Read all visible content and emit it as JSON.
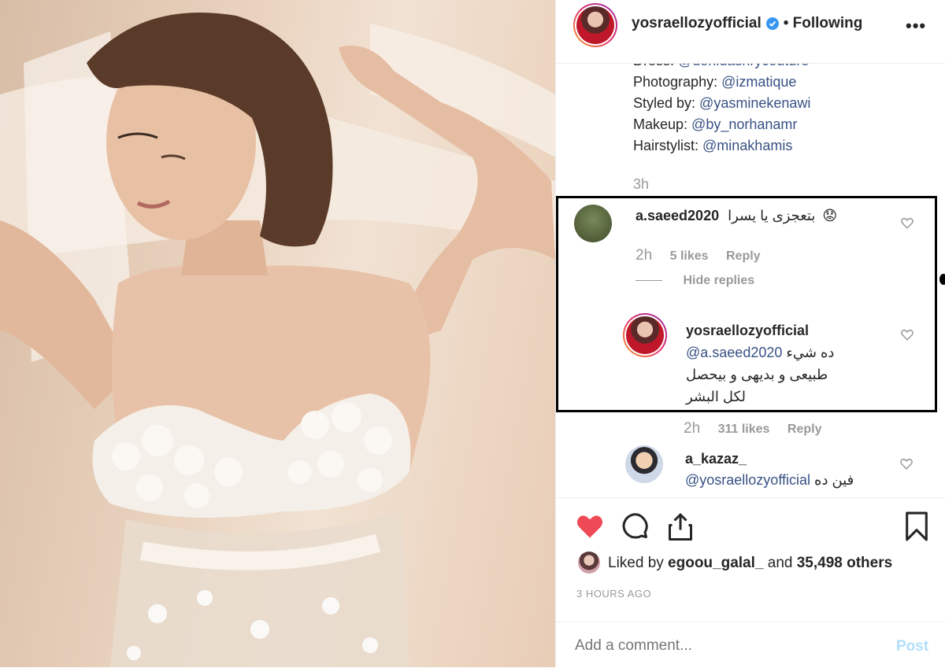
{
  "post": {
    "author": "yosraellozyofficial",
    "follow_status": "• Following",
    "more_icon": "ellipsis-icon",
    "caption_lines": [
      {
        "label": "Dress: ",
        "mention": "@donidashrycouture"
      },
      {
        "label": "Photography: ",
        "mention": "@izmatique"
      },
      {
        "label": "Styled by: ",
        "mention": "@yasminekenawi"
      },
      {
        "label": "Makeup: ",
        "mention": "@by_norhanamr"
      },
      {
        "label": "Hairstylist: ",
        "mention": "@minakhamis"
      }
    ],
    "caption_time": "3h"
  },
  "comments": [
    {
      "username": "a.saeed2020",
      "text": "بتعجزى يا يسرا",
      "emoji": "😟",
      "time": "2h",
      "likes": "5 likes",
      "reply": "Reply",
      "hide_replies": "Hide replies"
    }
  ],
  "reply": {
    "username": "yosraellozyofficial",
    "mention": "@a.saeed2020",
    "text_1": "ده شيء",
    "text_2": "طبيعى و بديهى و بيحصل",
    "text_3": "لكل البشر",
    "time": "2h",
    "likes": "311 likes",
    "reply": "Reply"
  },
  "comment2": {
    "username": "a_kazaz_",
    "mention": "@yosraellozyofficial",
    "text": "فين ده"
  },
  "actions": {
    "liked_prefix": "Liked by ",
    "liked_user": "egoou_galal_",
    "liked_mid": " and ",
    "liked_count": "35,498 others",
    "timestamp": "3 HOURS AGO"
  },
  "add_comment": {
    "placeholder": "Add a comment...",
    "post_label": "Post"
  },
  "colors": {
    "like_red": "#ed4956",
    "link_blue": "#385185",
    "verified_blue": "#3897f0",
    "post_disabled": "#b2dffc"
  }
}
